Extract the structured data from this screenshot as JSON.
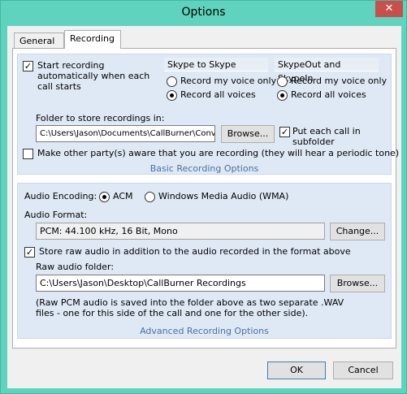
{
  "window": {
    "title": "Options",
    "close_glyph": "✕"
  },
  "tabs": [
    {
      "label": "General"
    },
    {
      "label": "Recording"
    }
  ],
  "basic": {
    "start_recording": {
      "checked": true,
      "line1": "Start recording",
      "line2": "automatically when each",
      "line3": "call starts"
    },
    "skype_to_skype": {
      "heading": "Skype to Skype",
      "opt_my": "Record my voice only",
      "opt_all": "Record all voices",
      "selected": "all"
    },
    "skypeout": {
      "heading": "SkypeOut and SkypeIn",
      "opt_my": "Record my voice only",
      "opt_all": "Record all voices",
      "selected": "all"
    },
    "folder_label": "Folder to store recordings in:",
    "folder_value": "C:\\Users\\Jason\\Documents\\CallBurner\\Conv",
    "browse_label": "Browse...",
    "subfolder": {
      "checked": true,
      "line1": "Put each call in",
      "line2": "subfolder"
    },
    "aware": {
      "checked": false,
      "label": "Make other party(s) aware that you are recording (they will hear a periodic tone)"
    },
    "caption": "Basic Recording Options"
  },
  "advanced": {
    "encoding_label": "Audio Encoding:",
    "acm_label": "ACM",
    "wma_label": "Windows Media Audio (WMA)",
    "encoding_selected": "acm",
    "format_label": "Audio Format:",
    "format_value": "PCM: 44.100 kHz, 16 Bit, Mono",
    "change_label": "Change...",
    "store_raw": {
      "checked": true,
      "label": "Store raw audio in addition to the audio recorded in the format above"
    },
    "raw_folder_label": "Raw audio folder:",
    "raw_folder_value": "C:\\Users\\Jason\\Desktop\\CallBurner Recordings",
    "browse_label": "Browse...",
    "note_line1": "(Raw PCM audio is saved into the folder above as two separate .WAV",
    "note_line2": "files - one for this side of the call and one for the other side).",
    "caption": "Advanced Recording Options"
  },
  "footer": {
    "ok_label": "OK",
    "cancel_label": "Cancel"
  },
  "colors": {
    "frame": "#5fd3bd",
    "group": "#dfe9f5",
    "caption": "#4a6fa0",
    "close": "#c7504a"
  }
}
